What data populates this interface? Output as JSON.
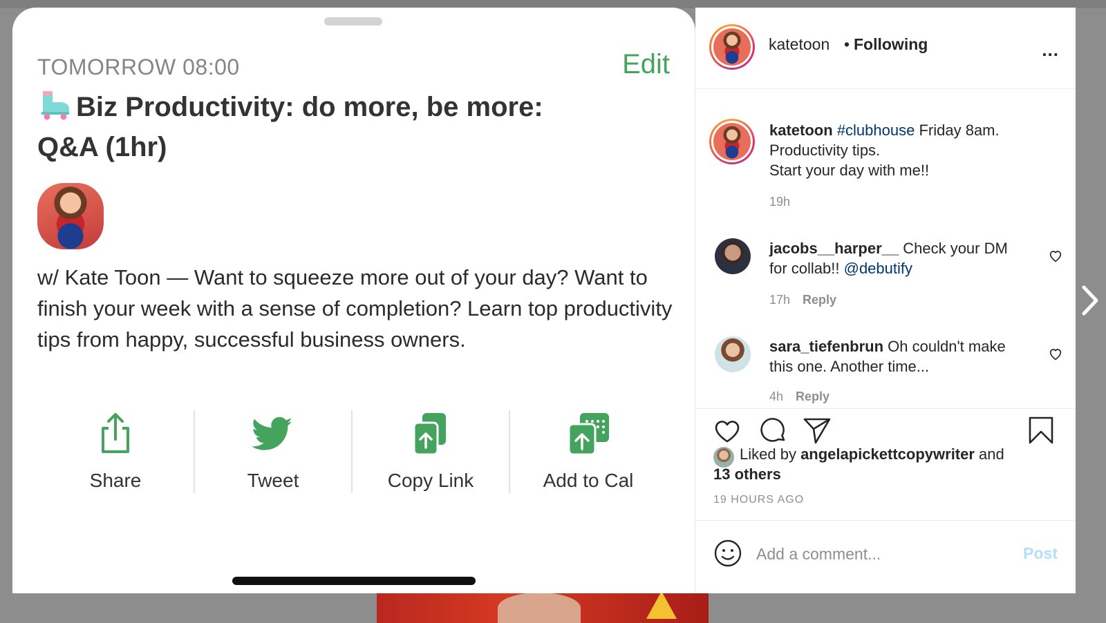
{
  "clubhouse": {
    "when": "TOMORROW 08:00",
    "edit_label": "Edit",
    "title": "Biz Productivity: do more, be more: Q&A (1hr)",
    "description": "w/ Kate Toon — Want to squeeze more out of your day? Want to finish your week with a sense of completion? Learn top productivity tips from happy, successful business owners.",
    "actions": [
      {
        "label": "Share",
        "icon": "share-icon"
      },
      {
        "label": "Tweet",
        "icon": "twitter-icon"
      },
      {
        "label": "Copy Link",
        "icon": "copy-link-icon"
      },
      {
        "label": "Add to Cal",
        "icon": "add-to-calendar-icon"
      }
    ],
    "accent": "#44a35d"
  },
  "instagram": {
    "header": {
      "username": "katetoon",
      "separator": "•",
      "follow_state": "Following",
      "more": "..."
    },
    "caption": {
      "username": "katetoon",
      "hashtag": "#clubhouse",
      "text_line1": " Friday 8am.",
      "text_line2": "Productivity tips.",
      "text_line3": "Start your day with me!!",
      "time": "19h"
    },
    "comments": [
      {
        "username": "jacobs__harper__",
        "text": " Check your DM for collab!! ",
        "mention": "@debutify",
        "time": "17h",
        "reply": "Reply"
      },
      {
        "username": "sara_tiefenbrun",
        "text": " Oh couldn't make this one. Another time...",
        "time": "4h",
        "reply": "Reply"
      }
    ],
    "likes": {
      "prefix": "Liked by ",
      "user": "angelapickettcopywriter",
      "middle": " and",
      "others": "13 others"
    },
    "time_ago": "19 HOURS AGO",
    "composer": {
      "placeholder": "Add a comment...",
      "post_label": "Post"
    },
    "link_color": "#00376b"
  }
}
